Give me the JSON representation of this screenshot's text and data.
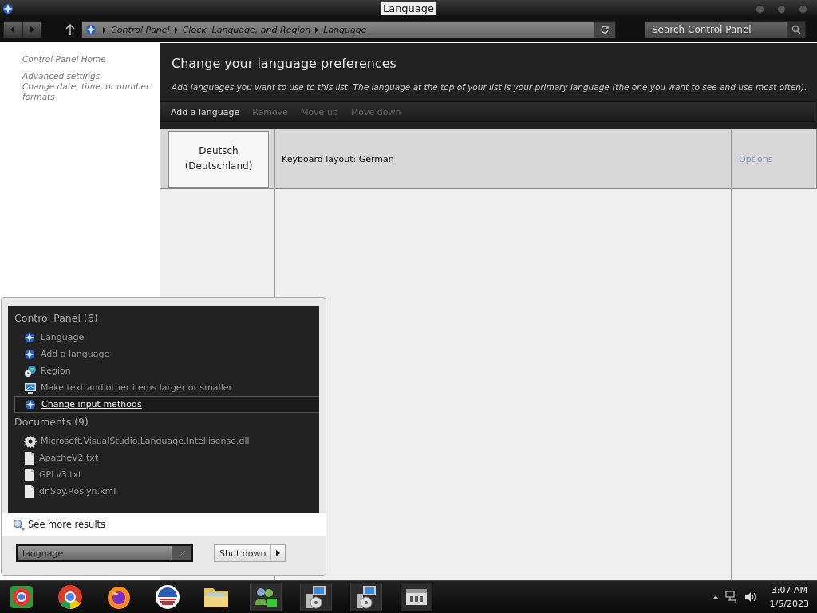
{
  "window": {
    "title": "Language"
  },
  "nav": {
    "breadcrumb": [
      "Control Panel",
      "Clock, Language, and Region",
      "Language"
    ],
    "search": {
      "placeholder": "Search Control Panel"
    }
  },
  "sidebar": {
    "items": [
      {
        "label": "Control Panel Home"
      },
      {
        "label": "Advanced settings"
      },
      {
        "label": "Change date, time, or number formats"
      }
    ]
  },
  "main": {
    "heading": "Change your language preferences",
    "description": "Add languages you want to use to this list. The language at the top of your list is your primary language (the one you want to see and use most often).",
    "toolbar": [
      {
        "label": "Add a language",
        "disabled": false
      },
      {
        "label": "Remove",
        "disabled": true
      },
      {
        "label": "Move up",
        "disabled": true
      },
      {
        "label": "Move down",
        "disabled": true
      }
    ],
    "languages": [
      {
        "name": "Deutsch (Deutschland)",
        "detail": "Keyboard layout: German",
        "action": "Options"
      }
    ]
  },
  "start_menu": {
    "groups": [
      {
        "title": "Control Panel (6)",
        "items": [
          {
            "label": "Language",
            "kind": "control-panel",
            "highlighted": false
          },
          {
            "label": "Add a language",
            "kind": "control-panel",
            "highlighted": false
          },
          {
            "label": "Region",
            "kind": "region",
            "highlighted": false
          },
          {
            "label": "Make text and other items larger or smaller",
            "kind": "display",
            "highlighted": false
          },
          {
            "label": "Change input methods",
            "kind": "control-panel",
            "highlighted": true
          }
        ]
      },
      {
        "title": "Documents (9)",
        "items": [
          {
            "label": "Microsoft.VisualStudio.Language.Intellisense.dll",
            "kind": "settings-file",
            "highlighted": false
          },
          {
            "label": "ApacheV2.txt",
            "kind": "text-file",
            "highlighted": false
          },
          {
            "label": "GPLv3.txt",
            "kind": "text-file",
            "highlighted": false
          },
          {
            "label": "dnSpy.Roslyn.xml",
            "kind": "text-file",
            "highlighted": false
          }
        ]
      }
    ],
    "see_more": "See more results",
    "search": {
      "value": "language"
    },
    "shutdown": "Shut down"
  },
  "taskbar": {
    "clock": {
      "time": "3:07 AM",
      "date": "1/5/2023"
    }
  }
}
